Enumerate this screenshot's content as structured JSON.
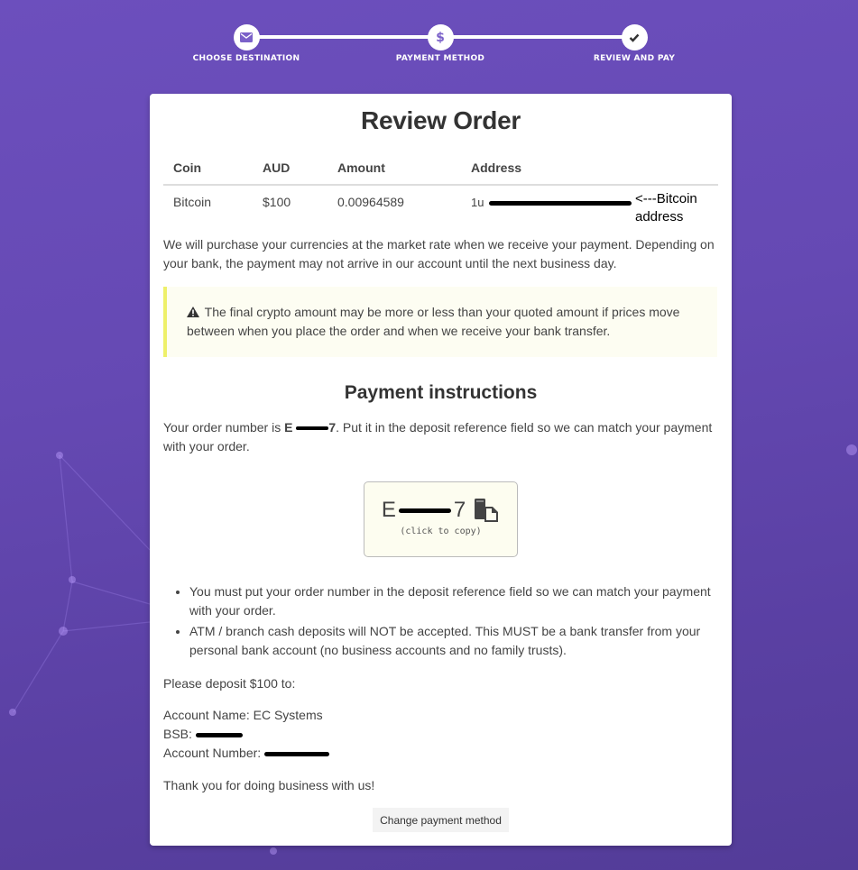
{
  "stepper": {
    "steps": [
      {
        "label": "CHOOSE DESTINATION",
        "icon": "envelope-icon",
        "state": "complete"
      },
      {
        "label": "PAYMENT METHOD",
        "icon": "dollar-icon",
        "state": "complete"
      },
      {
        "label": "REVIEW AND PAY",
        "icon": "check-icon",
        "state": "current"
      }
    ]
  },
  "card": {
    "title": "Review Order",
    "table": {
      "headers": [
        "Coin",
        "AUD",
        "Amount",
        "Address"
      ],
      "rows": [
        {
          "coin": "Bitcoin",
          "aud": "$100",
          "amount": "0.00964589",
          "address_visible_prefix": "1u",
          "address_redacted": true
        }
      ]
    },
    "annotation": {
      "line1": "<---Bitcoin",
      "line2": "address"
    },
    "intro_text": "We will purchase your currencies at the market rate when we receive your payment. Depending on your bank, the payment may not arrive in our account until the next business day.",
    "warning": {
      "icon": "warning-icon",
      "text": "The final crypto amount may be more or less than your quoted amount if prices move between when you place the order and when we receive your bank transfer.",
      "accent_color": "#eef06a"
    },
    "payment_instructions": {
      "title": "Payment instructions",
      "order_text_before": "Your order number is ",
      "order_prefix": "E",
      "order_suffix": "7",
      "order_text_after": ". Put it in the deposit reference field so we can match your payment with your order.",
      "copy_box": {
        "code_prefix": "E",
        "code_suffix": "7",
        "hint": "(click to copy)",
        "icon": "copy-icon"
      },
      "rules": [
        "You must put your order number in the deposit reference field so we can match your payment with your order.",
        "ATM / branch cash deposits will NOT be accepted. This MUST be a bank transfer from your personal bank account (no business accounts and no family trusts)."
      ],
      "deposit_text": "Please deposit $100 to:",
      "account_name_label": "Account Name:",
      "account_name": "EC Systems",
      "bsb_label": "BSB:",
      "account_number_label": "Account Number:",
      "thanks": "Thank you for doing business with us!"
    },
    "change_button": "Change payment method"
  },
  "colors": {
    "background": "#6549b3",
    "accent": "#6a4fbf"
  }
}
